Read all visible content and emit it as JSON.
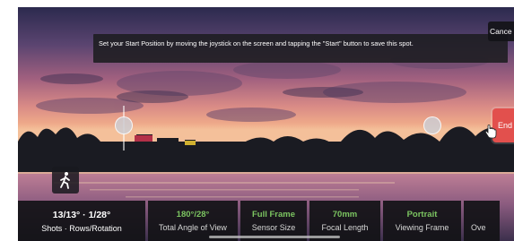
{
  "tooltip": {
    "text": "Set your Start Position by moving the joystick on the screen and tapping the \"Start\" button to save this spot."
  },
  "buttons": {
    "cancel_label": "Cance",
    "end_label": "End"
  },
  "stats": {
    "shots_value": "13/13° · 1/28°",
    "shots_label": "Shots · Rows/Rotation",
    "angle_value": "180°/28°",
    "angle_label": "Total Angle of View",
    "sensor_value": "Full Frame",
    "sensor_label": "Sensor Size",
    "focal_value": "70mm",
    "focal_label": "Focal Length",
    "viewing_value": "Portrait",
    "viewing_label": "Viewing Frame",
    "overlap_label": "Ove"
  },
  "icons": {
    "joystick": "walking-person-icon",
    "cursor": "hand-pointer-icon"
  },
  "colors": {
    "accent_green": "#7cc561",
    "end_button": "#e2504d"
  }
}
